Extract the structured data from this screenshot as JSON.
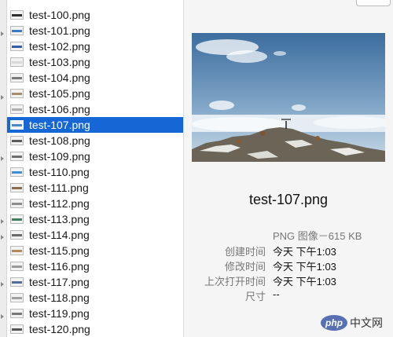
{
  "files": [
    "test-100.png",
    "test-101.png",
    "test-102.png",
    "test-103.png",
    "test-104.png",
    "test-105.png",
    "test-106.png",
    "test-107.png",
    "test-108.png",
    "test-109.png",
    "test-110.png",
    "test-111.png",
    "test-112.png",
    "test-113.png",
    "test-114.png",
    "test-115.png",
    "test-116.png",
    "test-117.png",
    "test-118.png",
    "test-119.png",
    "test-120.png"
  ],
  "selected_index": 7,
  "preview": {
    "title": "test-107.png",
    "kind_size": "PNG 图像－615 KB",
    "labels": {
      "created": "创建时间",
      "modified": "修改时间",
      "last_opened": "上次打开时间",
      "dimensions": "尺寸"
    },
    "values": {
      "created": "今天 下午1:03",
      "modified": "今天 下午1:03",
      "last_opened": "今天 下午1:03",
      "dimensions": "--"
    },
    "image_icon": "landscape-photo"
  },
  "watermark": {
    "logo": "php",
    "text": "中文网"
  },
  "colors": {
    "selection": "#1667d6",
    "sky_top": "#3b6d9e",
    "sky_bottom": "#c9dbe8",
    "watermark_logo": "#5670b3"
  }
}
